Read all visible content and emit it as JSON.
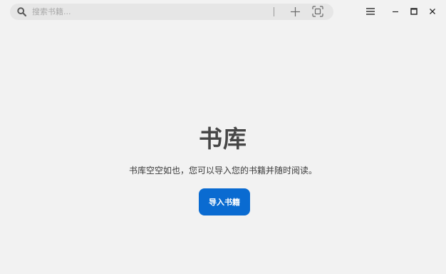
{
  "search": {
    "placeholder": "搜索书籍..."
  },
  "icons": {
    "search": "search-icon",
    "add": "plus-icon",
    "scan": "scan-icon",
    "menu": "hamburger-menu-icon",
    "minimize": "minimize-icon",
    "maximize": "maximize-icon",
    "close": "close-icon"
  },
  "library": {
    "title": "书库",
    "description": "书库空空如也，您可以导入您的书籍并随时阅读。",
    "import_label": "导入书籍"
  },
  "colors": {
    "background": "#f2f2f2",
    "search_bg": "#e6e6e6",
    "accent": "#0a6bd1",
    "title": "#474747"
  }
}
